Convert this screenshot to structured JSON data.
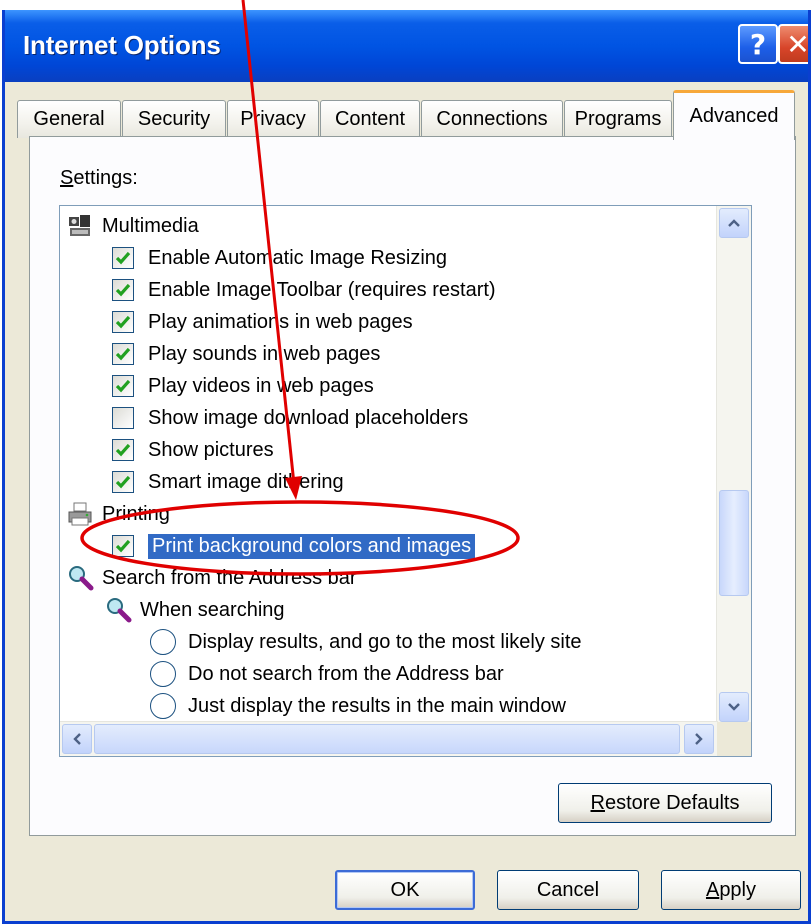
{
  "window": {
    "title": "Internet Options",
    "help_glyph": "?",
    "close_glyph": "✕"
  },
  "tabs": [
    {
      "label": "General"
    },
    {
      "label": "Security"
    },
    {
      "label": "Privacy"
    },
    {
      "label": "Content"
    },
    {
      "label": "Connections"
    },
    {
      "label": "Programs"
    },
    {
      "label": "Advanced",
      "active": true
    }
  ],
  "settings": {
    "label_first": "S",
    "label_rest": "ettings:",
    "items": [
      {
        "kind": "category",
        "icon": "multimedia-icon",
        "label": "Multimedia"
      },
      {
        "kind": "checkbox",
        "checked": true,
        "label": "Enable Automatic Image Resizing"
      },
      {
        "kind": "checkbox",
        "checked": true,
        "label": "Enable Image Toolbar (requires restart)"
      },
      {
        "kind": "checkbox",
        "checked": true,
        "label": "Play animations in web pages"
      },
      {
        "kind": "checkbox",
        "checked": true,
        "label": "Play sounds in web pages"
      },
      {
        "kind": "checkbox",
        "checked": true,
        "label": "Play videos in web pages"
      },
      {
        "kind": "checkbox",
        "checked": false,
        "label": "Show image download placeholders"
      },
      {
        "kind": "checkbox",
        "checked": true,
        "label": "Show pictures"
      },
      {
        "kind": "checkbox",
        "checked": true,
        "label": "Smart image dithering"
      },
      {
        "kind": "category",
        "icon": "printer-icon",
        "label": "Printing"
      },
      {
        "kind": "checkbox",
        "checked": true,
        "selected": true,
        "label": "Print background colors and images"
      },
      {
        "kind": "category",
        "icon": "search-magnifier-icon",
        "label": "Search from the Address bar"
      },
      {
        "kind": "subcategory",
        "icon": "search-magnifier-icon",
        "label": "When searching"
      },
      {
        "kind": "radio",
        "label": "Display results, and go to the most likely site"
      },
      {
        "kind": "radio",
        "label": "Do not search from the Address bar"
      },
      {
        "kind": "radio",
        "label": "Just display the results in the main window"
      }
    ]
  },
  "buttons": {
    "restore_first": "R",
    "restore_rest": "estore Defaults",
    "ok": "OK",
    "cancel": "Cancel",
    "apply_first": "A",
    "apply_rest": "pply"
  },
  "colors": {
    "titlebar": "#0054e3",
    "selection": "#316ac5",
    "checkmark": "#21a121",
    "annotation": "#e00000"
  }
}
